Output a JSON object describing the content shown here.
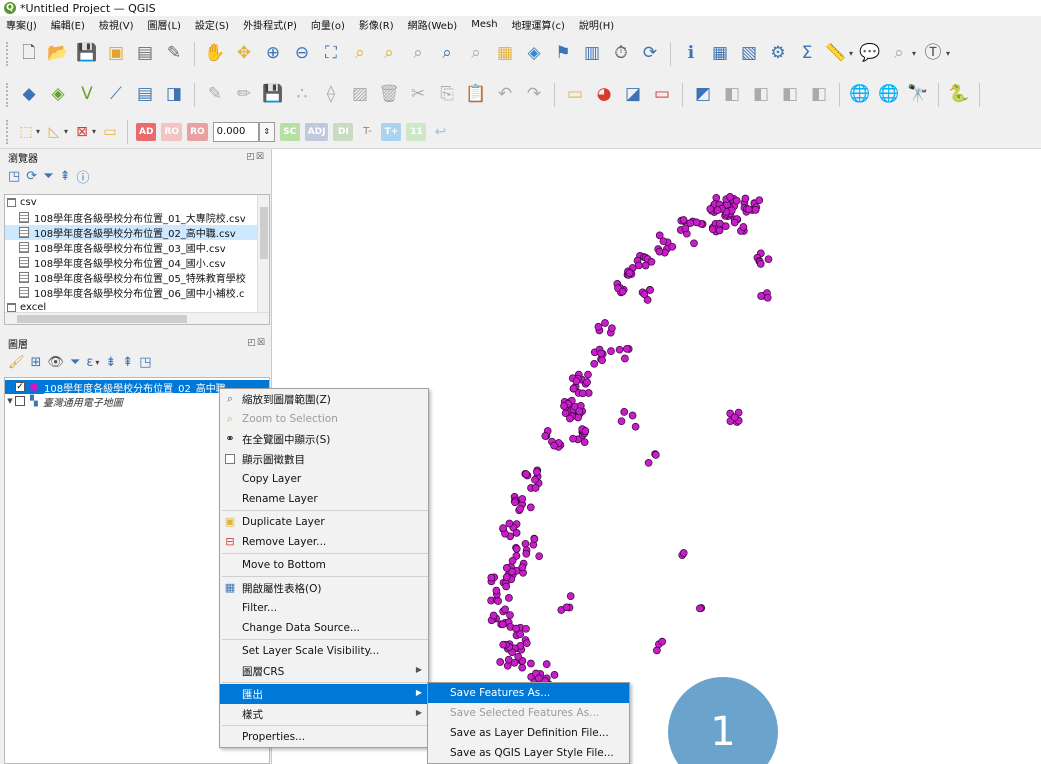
{
  "window": {
    "title": "*Untitled Project — QGIS"
  },
  "menubar": [
    "專案(J)",
    "編輯(E)",
    "檢視(V)",
    "圖層(L)",
    "設定(S)",
    "外掛程式(P)",
    "向量(o)",
    "影像(R)",
    "網路(Web)",
    "Mesh",
    "地理運算(c)",
    "說明(H)"
  ],
  "toolbar3": {
    "scale_value": "0.000",
    "text_minus": "T-",
    "text_plus": "T+"
  },
  "browser_panel": {
    "title": "瀏覽器",
    "items": [
      {
        "label": "csv",
        "kind": "folder"
      },
      {
        "label": "108學年度各級學校分布位置_01_大專院校.csv",
        "kind": "file"
      },
      {
        "label": "108學年度各級學校分布位置_02_高中職.csv",
        "kind": "file",
        "selected": true
      },
      {
        "label": "108學年度各級學校分布位置_03_國中.csv",
        "kind": "file"
      },
      {
        "label": "108學年度各級學校分布位置_04_國小.csv",
        "kind": "file"
      },
      {
        "label": "108學年度各級學校分布位置_05_特殊教育學校",
        "kind": "file"
      },
      {
        "label": "108學年度各級學校分布位置_06_國中小補校.c",
        "kind": "file"
      },
      {
        "label": "excel",
        "kind": "folder"
      }
    ]
  },
  "layers_panel": {
    "title": "圖層",
    "layers": [
      {
        "label": "108學年度各級學校分布位置_02_高中職",
        "checked": true,
        "selected": true,
        "color": "#c61ec8"
      },
      {
        "label": "臺灣通用電子地圖",
        "checked": false,
        "selected": false
      }
    ]
  },
  "context_menu": {
    "items": [
      {
        "label": "縮放到圖層範圍(Z)",
        "icon": "zoom-icon"
      },
      {
        "label": "Zoom to Selection",
        "icon": "zoom-selection-icon",
        "disabled": true
      },
      {
        "label": "在全覽圖中顯示(S)",
        "icon": "overview-icon"
      },
      {
        "label": "顯示圖徵數目",
        "icon": "checkbox-icon"
      },
      {
        "label": "Copy Layer"
      },
      {
        "label": "Rename Layer"
      },
      {
        "label": "Duplicate Layer",
        "icon": "duplicate-icon"
      },
      {
        "label": "Remove Layer...",
        "icon": "remove-icon"
      },
      {
        "label": "Move to Bottom"
      },
      {
        "label": "開啟屬性表格(O)",
        "icon": "table-icon"
      },
      {
        "label": "Filter..."
      },
      {
        "label": "Change Data Source..."
      },
      {
        "label": "Set Layer Scale Visibility..."
      },
      {
        "label": "圖層CRS",
        "submenu": true
      },
      {
        "label": "匯出",
        "submenu": true,
        "highlighted": true
      },
      {
        "label": "樣式",
        "submenu": true
      },
      {
        "label": "Properties..."
      }
    ]
  },
  "export_submenu": {
    "items": [
      {
        "label": "Save Features As...",
        "highlighted": true
      },
      {
        "label": "Save Selected Features As...",
        "disabled": true
      },
      {
        "label": "Save as Layer Definition File..."
      },
      {
        "label": "Save as QGIS Layer Style File..."
      }
    ]
  },
  "annotation": {
    "step_number": "1",
    "color": "#6aa4cc"
  },
  "colors": {
    "point_fill": "#c61ec8",
    "selection": "#0078d7",
    "qgis_green": "#589632"
  }
}
